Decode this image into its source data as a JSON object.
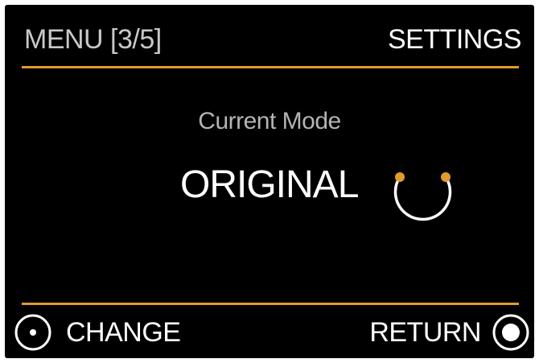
{
  "header": {
    "menu_position": "MENU [3/5]",
    "section_title": "SETTINGS"
  },
  "mode": {
    "label": "Current Mode",
    "value": "ORIGINAL",
    "icon": "arc-mode-icon"
  },
  "footer": {
    "change_label": "CHANGE",
    "change_icon": "small-dot-button-icon",
    "return_label": "RETURN",
    "return_icon": "large-dot-button-icon"
  },
  "colors": {
    "background": "#000000",
    "accent": "#e09a2e",
    "text": "#ffffff",
    "muted_text": "#b4b4b4"
  }
}
